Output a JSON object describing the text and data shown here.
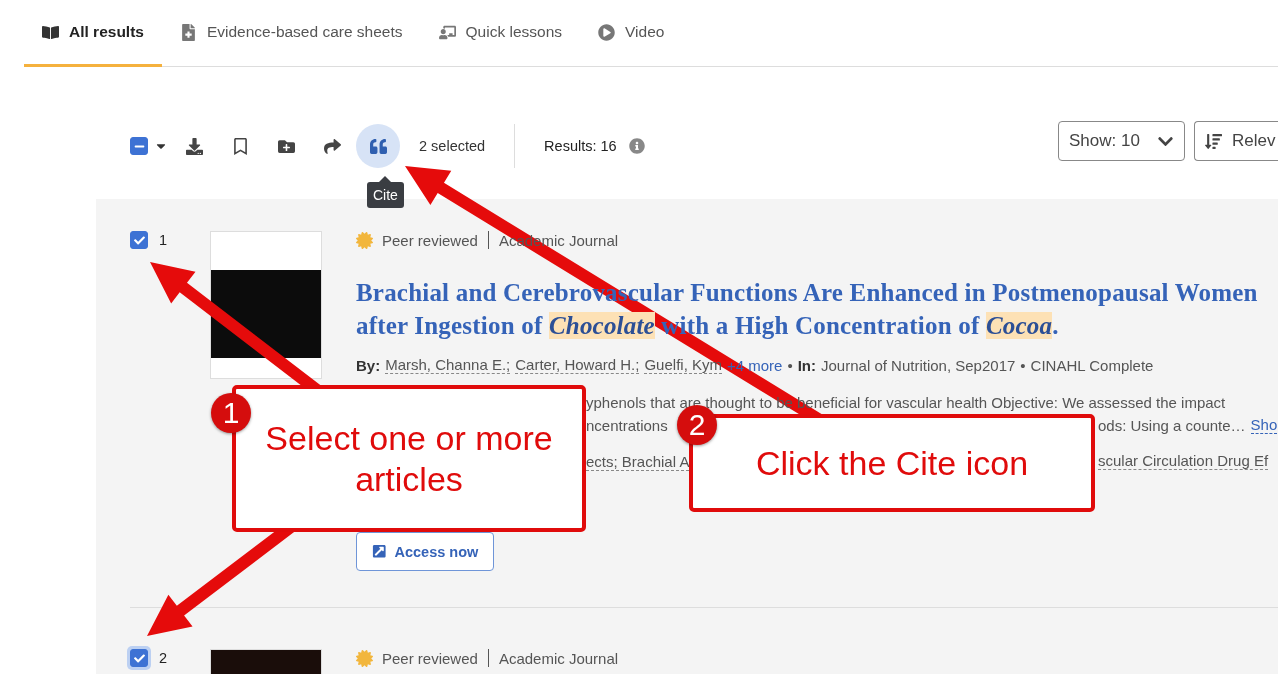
{
  "tabs": [
    {
      "label": "All results",
      "selected": true
    },
    {
      "label": "Evidence-based care sheets",
      "selected": false
    },
    {
      "label": "Quick lessons",
      "selected": false
    },
    {
      "label": "Video",
      "selected": false
    }
  ],
  "toolbar": {
    "select_all": {
      "indeterminate": true
    },
    "actions": [
      {
        "kind": "download",
        "selected": false
      },
      {
        "kind": "bookmark",
        "selected": false
      },
      {
        "kind": "folder",
        "selected": false
      },
      {
        "kind": "share",
        "selected": false
      },
      {
        "kind": "cite",
        "selected": true
      }
    ],
    "tooltip": "Cite",
    "selected_count": "2 selected",
    "results": "Results: 16",
    "show": "Show: 10",
    "sort": "Relev"
  },
  "results": [
    {
      "number": "1",
      "checked": true,
      "focused": false,
      "badge": "Peer reviewed",
      "type": "Academic Journal",
      "title_lines": [
        [
          {
            "text": "Brachial and Cerebrovascular Functions Are Enhanced in Postmenopausal Women",
            "highlight": false
          }
        ],
        [
          {
            "text": "after Ingestion of ",
            "highlight": false
          },
          {
            "text": "Chocolate",
            "highlight": true
          },
          {
            "text": " with a High Concentration of ",
            "highlight": false
          },
          {
            "text": "Cocoa",
            "highlight": true
          },
          {
            "text": ".",
            "highlight": false
          }
        ]
      ],
      "by_label": "By:",
      "authors": [
        "Marsh, Channa E.;",
        "Carter, Howard H.;",
        "Guelfi, Kym"
      ],
      "more": "+4 more",
      "separators": [
        "•",
        "•"
      ],
      "in_label": "In:",
      "source": "Journal of Nutrition, Sep2017",
      "database": "CINAHL Complete",
      "abstract_lines": [
        {
          "before": "yphenols that are thought to be beneficial for vascular health Objective: We assessed the impact"
        },
        {
          "before": "ncentrations",
          "after": "ods: Using a counte…",
          "link": "Sho"
        },
        {
          "before": "ects; Brachial A",
          "after": "scular Circulation Drug Ef"
        }
      ],
      "access": "Access now"
    },
    {
      "number": "2",
      "checked": true,
      "focused": true,
      "badge": "Peer reviewed",
      "type": "Academic Journal"
    }
  ],
  "callouts": [
    {
      "number": "1",
      "text": "Select one or more articles"
    },
    {
      "number": "2",
      "text": "Click the Cite icon"
    }
  ]
}
